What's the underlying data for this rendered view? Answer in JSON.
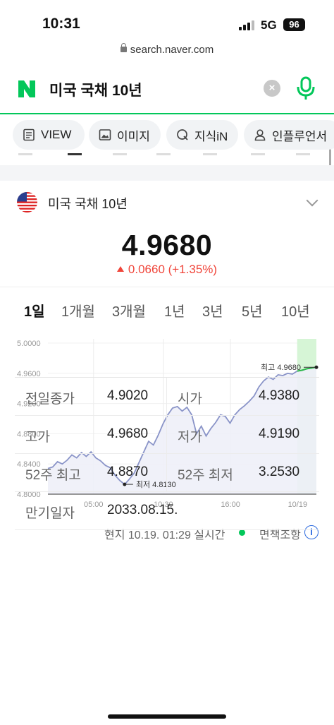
{
  "status_bar": {
    "time": "10:31",
    "network": "5G",
    "battery": "96"
  },
  "browser": {
    "url": "search.naver.com"
  },
  "search": {
    "query": "미국 국채 10년",
    "clear_label": "×"
  },
  "tabs": [
    {
      "label": "VIEW",
      "icon": "document-icon"
    },
    {
      "label": "이미지",
      "icon": "image-icon"
    },
    {
      "label": "지식iN",
      "icon": "q-icon"
    },
    {
      "label": "인플루언서",
      "icon": "person-icon"
    }
  ],
  "instrument": {
    "name": "미국 국채 10년",
    "flag": "us-flag",
    "price": "4.9680",
    "change": "0.0660 (+1.35%)",
    "change_color": "#f0453a"
  },
  "periods": [
    "1일",
    "1개월",
    "3개월",
    "1년",
    "3년",
    "5년",
    "10년"
  ],
  "active_period": "1일",
  "chart_data": {
    "type": "line",
    "x_ticks": [
      "05:00",
      "10:30",
      "16:00",
      "10/19"
    ],
    "y_ticks": [
      "5.0000",
      "4.9600",
      "4.9200",
      "4.8800",
      "4.8400",
      "4.8000"
    ],
    "ylim": [
      4.8,
      5.0
    ],
    "high_label": "최고 4.9680",
    "low_label": "최저 4.8130",
    "line_color": "#8a94c8",
    "fill_color": "#eef0f8",
    "highlight_color": "#d6f5d6",
    "series": [
      {
        "name": "",
        "values": [
          4.834,
          4.836,
          4.843,
          4.84,
          4.845,
          4.852,
          4.848,
          4.855,
          4.85,
          4.856,
          4.848,
          4.844,
          4.838,
          4.835,
          4.825,
          4.818,
          4.813,
          4.82,
          4.828,
          4.842,
          4.856,
          4.87,
          4.865,
          4.878,
          4.893,
          4.905,
          4.914,
          4.916,
          4.91,
          4.915,
          4.905,
          4.88,
          4.89,
          4.877,
          4.887,
          4.895,
          4.905,
          4.903,
          4.894,
          4.905,
          4.912,
          4.917,
          4.923,
          4.93,
          4.942,
          4.95,
          4.955,
          4.952,
          4.958,
          4.957,
          4.96,
          4.959,
          4.963,
          4.964,
          4.966,
          4.967,
          4.968
        ]
      }
    ],
    "highlight_from_index": 52
  },
  "update": {
    "live_text": "현지 10.19. 01:29 실시간",
    "disclaimer": "면책조항",
    "info_label": "i"
  },
  "stats": [
    {
      "label1": "전일종가",
      "value1": "4.9020",
      "label2": "시가",
      "value2": "4.9380"
    },
    {
      "label1": "고가",
      "value1": "4.9680",
      "label2": "저가",
      "value2": "4.9190"
    },
    {
      "label1": "52주 최고",
      "value1": "4.8870",
      "label2": "52주 최저",
      "value2": "3.2530"
    },
    {
      "label1": "만기일자",
      "value1": "2033.08.15.",
      "label2": "",
      "value2": ""
    }
  ]
}
